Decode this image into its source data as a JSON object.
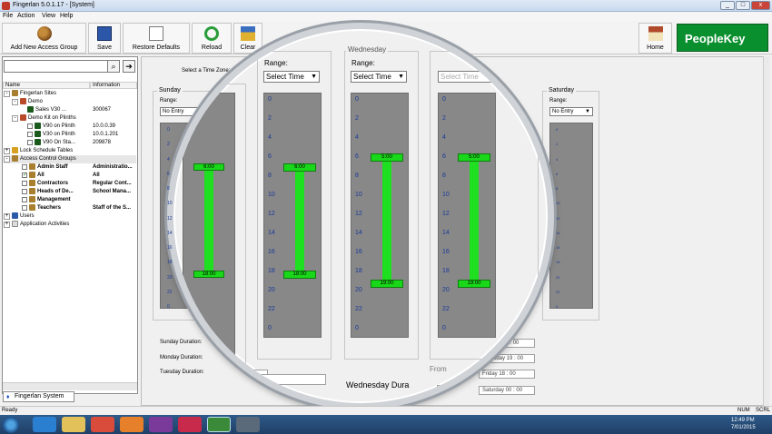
{
  "window": {
    "title": "Fingerlan 5.0.1.17 - [System]",
    "min_label": "_",
    "max_label": "□",
    "close_label": "x"
  },
  "menu": [
    "File",
    "Action",
    "View",
    "Help"
  ],
  "toolbar": {
    "add_group": "Add New Access Group",
    "save": "Save",
    "restore": "Restore Defaults",
    "reload": "Reload",
    "clear": "Clear",
    "home": "Home",
    "brand": "PeopleKey"
  },
  "tree": {
    "col_name": "Name",
    "col_info": "Information",
    "nodes": [
      {
        "label": "Fingerlan Sites",
        "info": ""
      },
      {
        "label": "Demo",
        "info": ""
      },
      {
        "label": "Sales V30 ...",
        "info": "300067"
      },
      {
        "label": "Demo Kit on Plinths",
        "info": ""
      },
      {
        "label": "V90 on Plinth",
        "info": "10.0.0.39"
      },
      {
        "label": "V30 on Plinth",
        "info": "10.0.1.201"
      },
      {
        "label": "V90 On Sta...",
        "info": "209878"
      },
      {
        "label": "Lock Schedule Tables",
        "info": ""
      },
      {
        "label": "Access Control Groups",
        "info": ""
      },
      {
        "label": "Admin Staff",
        "info": "Administratio..."
      },
      {
        "label": "All",
        "info": "All"
      },
      {
        "label": "Contractors",
        "info": "Regular Cont..."
      },
      {
        "label": "Heads of De...",
        "info": "School Mana..."
      },
      {
        "label": "Management",
        "info": ""
      },
      {
        "label": "Teachers",
        "info": "Staff of the S..."
      },
      {
        "label": "Users",
        "info": ""
      },
      {
        "label": "Application Activities",
        "info": ""
      }
    ],
    "tab": "Fingerlan System"
  },
  "schedule": {
    "select_timezone_label": "Select a Time Zone:",
    "days": {
      "sunday": "Sunday",
      "wednesday": "Wednesday",
      "saturday": "Saturday"
    },
    "range_label": "Range:",
    "no_entry": "No Entry",
    "select_time": "Select Time",
    "ticks": [
      "0",
      "2",
      "4",
      "6",
      "8",
      "10",
      "12",
      "14",
      "16",
      "18",
      "20",
      "22",
      "0"
    ],
    "sunday_start": "6:00",
    "sunday_end": "18:00",
    "mid_start": "6:00",
    "mid_end": "18:00",
    "wed_start": "5:00",
    "wed_end": "19:00",
    "thu_start": "5:00",
    "thu_end": "19:00",
    "durations": {
      "sunday": "Sunday Duration:",
      "monday": "Monday Duration:",
      "tuesday": "Tuesday Duration:",
      "wednesday": "Wednesday Dura",
      "from": "From"
    },
    "right_fields": [
      "Thursday 19 : 00",
      "Friday 18 : 00",
      "Saturday 00 : 00"
    ],
    "right_top_field": "Sunday 19 : 00",
    "left_fields": [
      "Mo",
      "Tuesday 0"
    ],
    "day_zero": "day 00 : 00"
  },
  "status": {
    "left": "Ready",
    "num": "NUM",
    "scrl": "SCRL"
  },
  "taskbar": {
    "time": "12:49 PM",
    "date": "7/01/2015"
  }
}
